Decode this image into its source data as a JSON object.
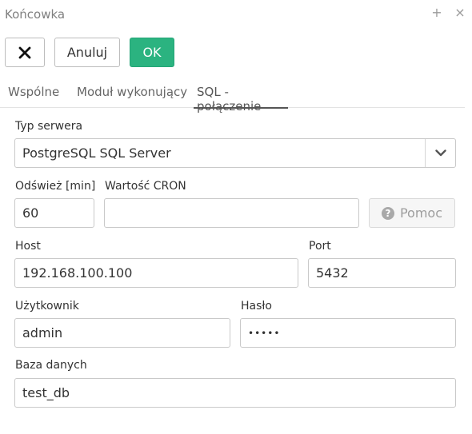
{
  "window": {
    "title": "Końcowka",
    "plus_icon": "+",
    "close_icon": "×"
  },
  "toolbar": {
    "close_label": "✕",
    "cancel_label": "Anuluj",
    "ok_label": "OK"
  },
  "tabs": [
    {
      "label": "Wspólne",
      "active": false
    },
    {
      "label": "Moduł wykonujący",
      "active": false
    },
    {
      "label": "SQL - połączenie",
      "active": true
    }
  ],
  "form": {
    "server_type": {
      "label": "Typ serwera",
      "value": "PostgreSQL SQL Server"
    },
    "refresh": {
      "label": "Odśwież [min]",
      "value": "60"
    },
    "cron": {
      "label": "Wartość CRON",
      "value": ""
    },
    "help_button": {
      "label": "Pomoc",
      "icon": "?"
    },
    "host": {
      "label": "Host",
      "value": "192.168.100.100"
    },
    "port": {
      "label": "Port",
      "value": "5432"
    },
    "user": {
      "label": "Użytkownik",
      "value": "admin"
    },
    "password": {
      "label": "Hasło",
      "value": "•••••"
    },
    "database": {
      "label": "Baza danych",
      "value": "test_db"
    }
  },
  "colors": {
    "ok_button": "#2bb380",
    "active_tab_underline": "#555555"
  }
}
